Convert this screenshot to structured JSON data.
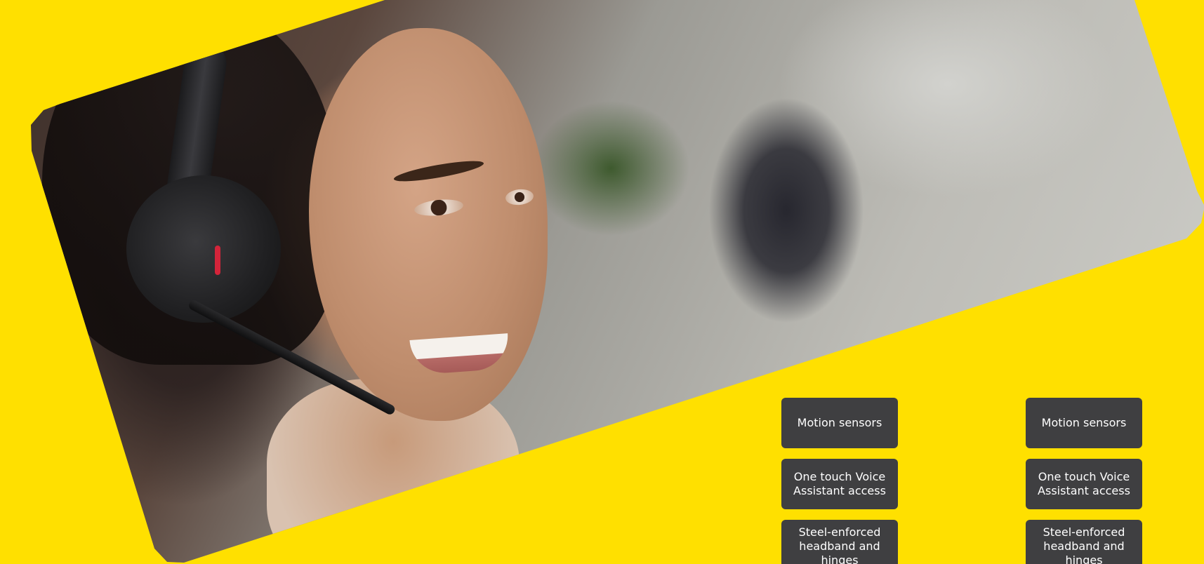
{
  "colors": {
    "background": "#FFE000",
    "button_bg": "#3F3F41",
    "button_text": "#FFFFFF",
    "headset_accent": "#D4243A"
  },
  "hero": {
    "image": "woman-wearing-headset-photo"
  },
  "feature_columns": [
    {
      "items": [
        {
          "label": "Motion sensors"
        },
        {
          "label": "One touch Voice Assistant access"
        },
        {
          "label": "Steel-enforced headband and hinges"
        }
      ]
    },
    {
      "items": [
        {
          "label": "Motion sensors"
        },
        {
          "label": "One touch Voice Assistant access"
        },
        {
          "label": "Steel-enforced headband and hinges"
        }
      ]
    }
  ]
}
